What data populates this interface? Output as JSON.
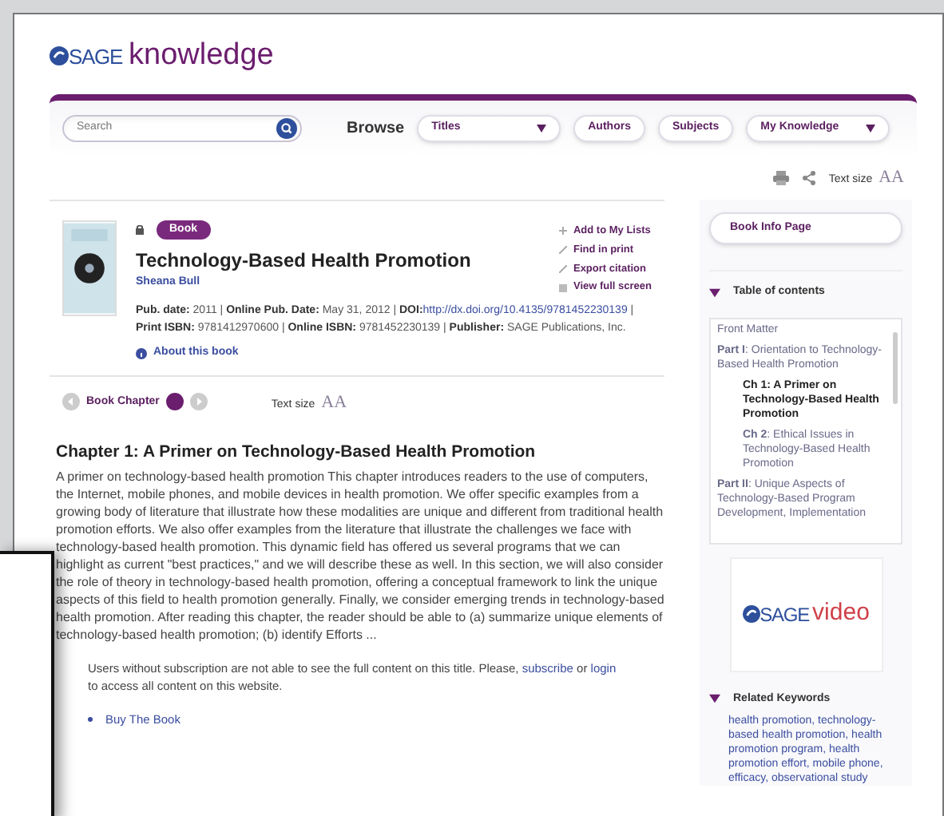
{
  "logo": {
    "brand": "SAGE",
    "product": "knowledge"
  },
  "nav": {
    "search_placeholder": "Search",
    "browse_label": "Browse",
    "menus": [
      {
        "label": "Titles",
        "kind": "dropdown"
      },
      {
        "label": "Authors",
        "kind": "button"
      },
      {
        "label": "Subjects",
        "kind": "button"
      },
      {
        "label": "My Knowledge",
        "kind": "dropdown"
      }
    ]
  },
  "tools": {
    "text_size_label": "Text size",
    "text_size_glyph": "AA"
  },
  "book": {
    "badge": "Book",
    "title": "Technology-Based Health Promotion",
    "author": "Sheana Bull",
    "meta": [
      {
        "label": "Pub. date:",
        "value": "2011",
        "kind": "text"
      },
      {
        "label": "Online Pub. Date:",
        "value": "May 31, 2012",
        "kind": "text"
      },
      {
        "label": "DOI:",
        "value": "http://dx.doi.org/10.4135/9781452230139",
        "kind": "link"
      },
      {
        "label": "Print ISBN:",
        "value": "9781412970600",
        "kind": "text"
      },
      {
        "label": "Online ISBN:",
        "value": "9781452230139",
        "kind": "text"
      },
      {
        "label": "Publisher:",
        "value": "SAGE Publications, Inc.",
        "kind": "text"
      }
    ],
    "actions": [
      {
        "label": "Add to My Lists",
        "kind": "plus"
      },
      {
        "label": "Find in print",
        "kind": "pen"
      },
      {
        "label": "Export citation",
        "kind": "pen"
      },
      {
        "label": "View full screen",
        "kind": "screen"
      }
    ],
    "separator": "|",
    "about": "About this book"
  },
  "chapter_nav": {
    "label": "Book Chapter",
    "text_size_label": "Text size",
    "text_size_glyph": "AA"
  },
  "chapter": {
    "title": "Chapter 1: A Primer on Technology-Based Health Promotion",
    "abstract": "A primer on technology-based health promotion This chapter introduces readers to the use of computers, the Internet, mobile phones, and mobile devices in health promotion. We offer specific examples from a growing body of literature that illustrate how these modalities are unique and different from traditional health promotion efforts. We also offer examples from the literature that illustrate the challenges we face with technology-based health promotion. This dynamic field has offered us several programs that we can highlight as current \"best practices,\" and we will describe these as well. In this section, we will also consider the role of theory in technology-based health promotion, offering a conceptual framework to link the unique aspects of this field to health promotion generally. Finally, we consider emerging trends in technology-based health promotion. After reading this chapter, the reader should be able to (a) summarize unique elements of technology-based health promotion; (b) identify Efforts ...",
    "notice_1": "Users without subscription are not able to see the full content on this title. Please,",
    "notice_link_1": "subscribe",
    "notice_or": "or",
    "notice_link_2": "login",
    "notice_2": "to access all content on this website.",
    "buy_link": "Buy The Book"
  },
  "sidebar": {
    "book_info_button": "Book Info Page",
    "toc": {
      "title": "Table of contents",
      "expanded": true,
      "items": [
        {
          "text": "Front Matter",
          "selected": false
        },
        {
          "text": "**Part I**: Orientation to Technology-Based Health Promotion",
          "selected": false,
          "children": [
            {
              "text": "Ch 1: A Primer on Technology-Based Health Promotion",
              "selected": true
            },
            {
              "text": "**Ch 2**: Ethical Issues in Technology-Based Health Promotion",
              "selected": false
            }
          ]
        },
        {
          "text": "**Part II**: Unique Aspects of Technology-Based Program Development, Implementation",
          "selected": false
        }
      ]
    },
    "ad": {
      "brand": "SAGE",
      "product": "video"
    },
    "keywords": {
      "title": "Related Keywords",
      "expanded": true,
      "text": "health promotion, technology-based health promotion, health promotion program, health promotion effort, mobile phone, efficacy, observational study"
    }
  }
}
